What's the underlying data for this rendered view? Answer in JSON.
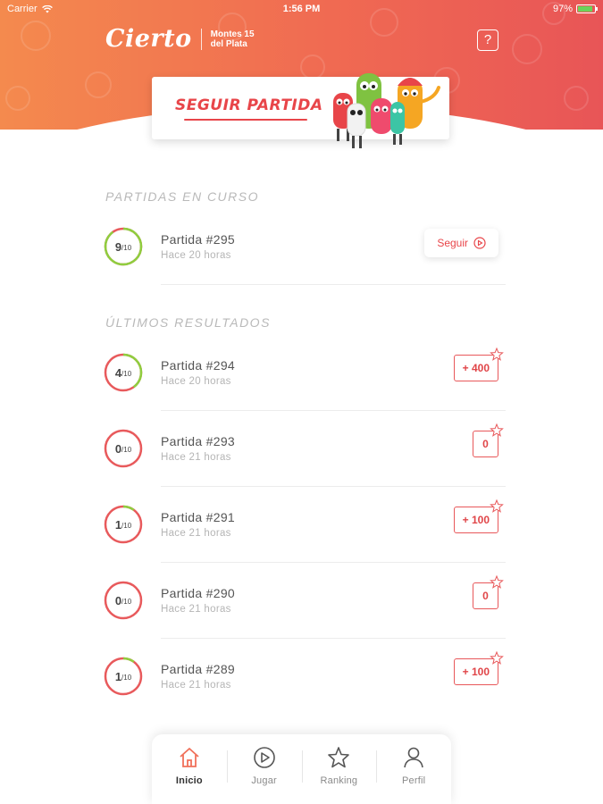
{
  "status_bar": {
    "carrier": "Carrier",
    "time": "1:56 PM",
    "battery": "97%"
  },
  "header": {
    "logo_text": "Cierto",
    "brand_line1": "Montes",
    "brand_line2": "del Plata",
    "brand_badge": "15",
    "help_label": "?"
  },
  "continue_card": {
    "label": "SEGUIR PARTIDA"
  },
  "in_progress": {
    "title": "PARTIDAS EN CURSO",
    "games": [
      {
        "score": "9",
        "total": "/10",
        "progress": 0.9,
        "name": "Partida #295",
        "time": "Hace 20 horas",
        "action": "Seguir"
      }
    ]
  },
  "results": {
    "title": "ÚLTIMOS RESULTADOS",
    "games": [
      {
        "score": "4",
        "total": "/10",
        "progress": 0.4,
        "name": "Partida #294",
        "time": "Hace 20 horas",
        "points": "+ 400"
      },
      {
        "score": "0",
        "total": "/10",
        "progress": 0.0,
        "name": "Partida #293",
        "time": "Hace 21 horas",
        "points": "0"
      },
      {
        "score": "1",
        "total": "/10",
        "progress": 0.1,
        "name": "Partida #291",
        "time": "Hace 21 horas",
        "points": "+ 100"
      },
      {
        "score": "0",
        "total": "/10",
        "progress": 0.0,
        "name": "Partida #290",
        "time": "Hace 21 horas",
        "points": "0"
      },
      {
        "score": "1",
        "total": "/10",
        "progress": 0.1,
        "name": "Partida #289",
        "time": "Hace 21 horas",
        "points": "+ 100"
      }
    ]
  },
  "tabs": [
    {
      "label": "Inicio",
      "icon": "home-icon",
      "active": true
    },
    {
      "label": "Jugar",
      "icon": "play-icon",
      "active": false
    },
    {
      "label": "Ranking",
      "icon": "star-icon",
      "active": false
    },
    {
      "label": "Perfil",
      "icon": "user-icon",
      "active": false
    }
  ],
  "colors": {
    "accent": "#e84549",
    "gradient_start": "#f48a4e",
    "gradient_end": "#e85557",
    "ring_bg": "#e85a5c",
    "ring_progress": "#8fce3f"
  }
}
